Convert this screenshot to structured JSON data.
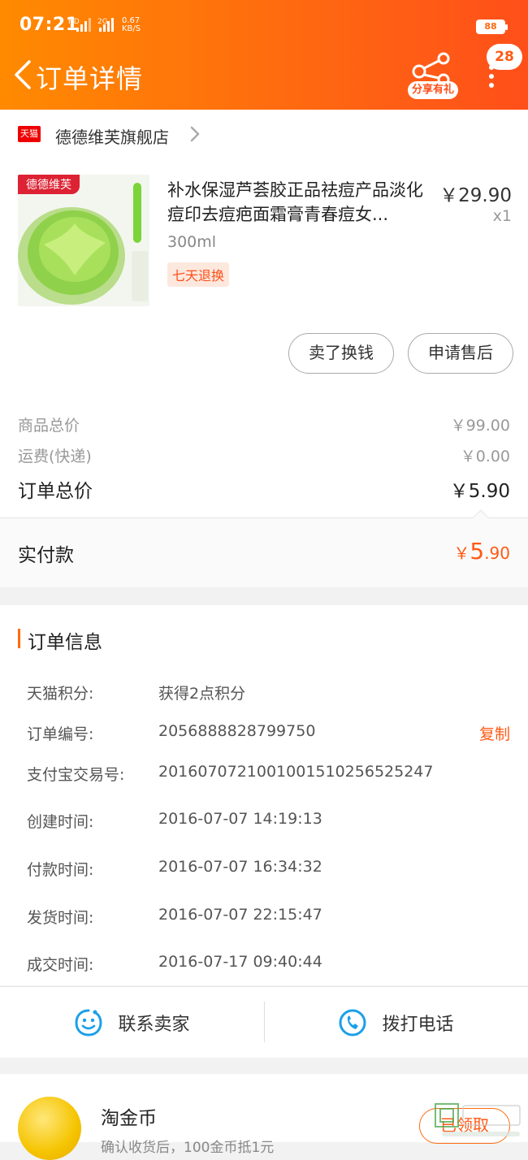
{
  "status_bar": {
    "time": "07:21",
    "network_1": "HD",
    "network_2": "2G",
    "speed_value": "0.67",
    "speed_unit": "KB/S",
    "battery": "88"
  },
  "header": {
    "title": "订单详情",
    "share_label": "分享有礼",
    "badge_count": "28",
    "accent": "#ff6a10"
  },
  "store": {
    "logo_text": "天猫",
    "name": "德德维芙旗舰店"
  },
  "product": {
    "image_tag": "德德维芙",
    "title": "补水保湿芦荟胶正品祛痘产品淡化痘印去痘疤面霜膏青春痘女...",
    "spec": "300ml",
    "return_badge": "七天退换",
    "price": "￥29.90",
    "quantity": "x1",
    "buttons": [
      "卖了换钱",
      "申请售后"
    ]
  },
  "totals": {
    "rows": [
      {
        "label": "商品总价",
        "value": "￥99.00"
      },
      {
        "label": "运费(快递)",
        "value": "￥0.00"
      }
    ],
    "order_total_label": "订单总价",
    "order_total_value": "￥5.90"
  },
  "payment": {
    "label": "实付款",
    "currency": "￥",
    "amount_int": "5",
    "amount_dec": ".90",
    "color": "#ff5a14"
  },
  "order_info": {
    "title": "订单信息",
    "copy_label": "复制",
    "rows": [
      {
        "key": "天猫积分:",
        "value": "获得2点积分"
      },
      {
        "key": "订单编号:",
        "value": "2056888828799750"
      },
      {
        "key": "支付宝交易号:",
        "value": "2016070721001001510256525247"
      },
      {
        "key": "创建时间:",
        "value": "2016-07-07 14:19:13"
      },
      {
        "key": "付款时间:",
        "value": "2016-07-07 16:34:32"
      },
      {
        "key": "发货时间:",
        "value": "2016-07-07 22:15:47"
      },
      {
        "key": "成交时间:",
        "value": "2016-07-17 09:40:44"
      }
    ]
  },
  "actions": {
    "contact_seller": "联系卖家",
    "call_phone": "拨打电话"
  },
  "coin": {
    "title": "淘金币",
    "subtitle": "确认收货后，100金币抵1元",
    "button": "已领取"
  },
  "icons": [
    "back-icon",
    "share-icon",
    "more-icon",
    "chevron-right-icon",
    "chat-smile-icon",
    "phone-icon",
    "coin-icon"
  ]
}
